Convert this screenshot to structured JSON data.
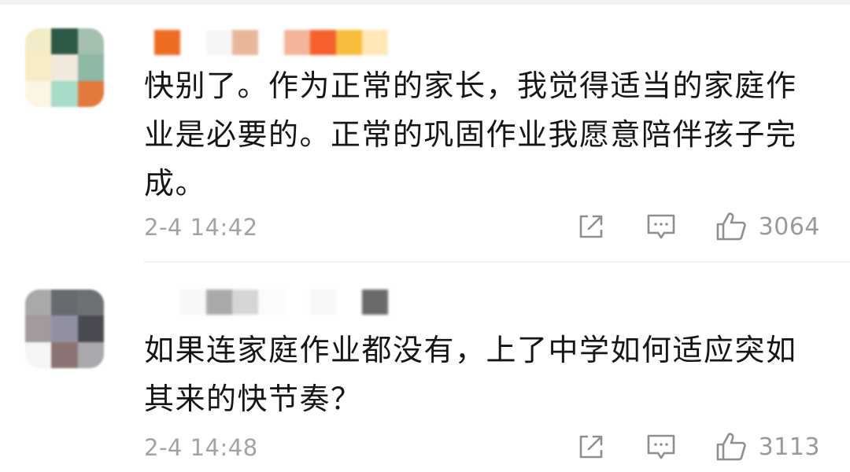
{
  "comments": [
    {
      "text": "快别了。作为正常的家长，我觉得适当的家庭作业是必要的。正常的巩固作业我愿意陪伴孩子完成。",
      "timestamp": "2-4 14:42",
      "likes": "3064",
      "avatar_colors": [
        "#f4ecc6",
        "#2d5a47",
        "#a4bfae",
        "#f6edc4",
        "#f2e9dd",
        "#8db8a4",
        "#fbf5e1",
        "#a7dcc8",
        "#e4793d"
      ],
      "name_colors": [
        "#ee6b22",
        "#ffffff",
        "#f6f6f6",
        "#e8b79a",
        "#ffffff",
        "#f3b49a",
        "#f4612c",
        "#f9bd3c",
        "#ffe7b8"
      ],
      "icons": [
        "share-icon",
        "comment-icon",
        "thumbs-up-icon"
      ]
    },
    {
      "text": "如果连家庭作业都没有，上了中学如何适应突如其来的快节奏？",
      "timestamp": "2-4 14:48",
      "likes": "3113",
      "avatar_colors": [
        "#a8a9a9",
        "#686b6e",
        "#6e7174",
        "#a39b9b",
        "#9190a3",
        "#4a4b52",
        "#f5f5f7",
        "#8d7474",
        "#a8a8ad"
      ],
      "name_colors": [
        "#ffffff",
        "#f8f8f8",
        "#aaaaaa",
        "#d6d6d6",
        "#fbfbfb",
        "#ffffff",
        "#f7f7f7",
        "#ffffff",
        "#6a6a6a"
      ],
      "icons": [
        "share-icon",
        "comment-icon",
        "thumbs-up-icon"
      ]
    }
  ]
}
